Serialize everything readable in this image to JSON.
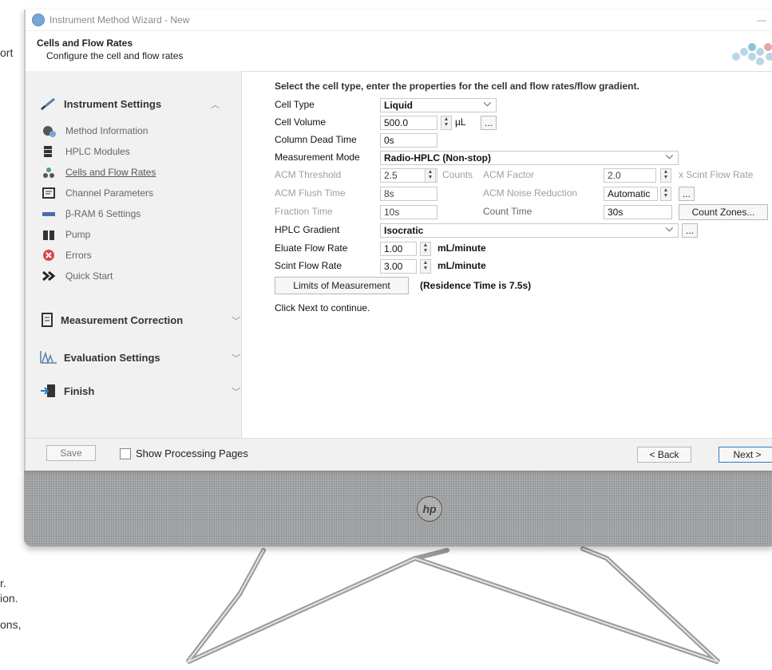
{
  "background": {
    "fragments": [
      "ort",
      "r.",
      "ion.",
      "ons,"
    ]
  },
  "window": {
    "title": "Instrument Method Wizard - New",
    "minimize_glyph": "—"
  },
  "header": {
    "title": "Cells and Flow Rates",
    "subtitle": "Configure the cell and flow rates"
  },
  "sidebar": {
    "instrument_settings": "Instrument Settings",
    "items": [
      {
        "label": "Method Information",
        "icon": "gear-icon"
      },
      {
        "label": "HPLC Modules",
        "icon": "modules-icon"
      },
      {
        "label": "Cells and Flow Rates",
        "icon": "cells-icon"
      },
      {
        "label": "Channel Parameters",
        "icon": "channel-icon"
      },
      {
        "label": "β-RAM 6 Settings",
        "icon": "bram-icon"
      },
      {
        "label": "Pump",
        "icon": "pump-icon"
      },
      {
        "label": "Errors",
        "icon": "error-icon"
      },
      {
        "label": "Quick Start",
        "icon": "quick-start-icon"
      }
    ],
    "measurement_correction": "Measurement Correction",
    "evaluation_settings": "Evaluation Settings",
    "finish": "Finish"
  },
  "form": {
    "instruction": "Select the cell type, enter the properties for the cell and flow rates/flow gradient.",
    "cell_type_label": "Cell Type",
    "cell_type_value": "Liquid",
    "cell_volume_label": "Cell Volume",
    "cell_volume_value": "500.0",
    "cell_volume_unit": "µL",
    "column_dead_time_label": "Column Dead Time",
    "column_dead_time_value": "0s",
    "measurement_mode_label": "Measurement Mode",
    "measurement_mode_value": "Radio-HPLC (Non-stop)",
    "acm_threshold_label": "ACM Threshold",
    "acm_threshold_value": "2.5",
    "acm_threshold_unit": "Counts",
    "acm_factor_label": "ACM Factor",
    "acm_factor_value": "2.0",
    "acm_factor_unit": "x Scint Flow Rate",
    "acm_flush_time_label": "ACM Flush Time",
    "acm_flush_time_value": "8s",
    "acm_noise_reduction_label": "ACM Noise Reduction",
    "acm_noise_reduction_value": "Automatic",
    "fraction_time_label": "Fraction Time",
    "fraction_time_value": "10s",
    "count_time_label": "Count Time",
    "count_time_value": "30s",
    "count_zones_button": "Count Zones...",
    "hplc_gradient_label": "HPLC Gradient",
    "hplc_gradient_value": "Isocratic",
    "eluate_flow_rate_label": "Eluate Flow Rate",
    "eluate_flow_rate_value": "1.00",
    "eluate_flow_rate_unit": "mL/minute",
    "scint_flow_rate_label": "Scint Flow Rate",
    "scint_flow_rate_value": "3.00",
    "scint_flow_rate_unit": "mL/minute",
    "limits_button": "Limits of Measurement",
    "residence_time": "(Residence Time is 7.5s)",
    "next_hint": "Click Next to continue.",
    "ellipsis": "..."
  },
  "footer": {
    "save": "Save",
    "show_processing": "Show Processing Pages",
    "back": "< Back",
    "next": "Next >"
  },
  "colors": {
    "accent": "#7aa6d6",
    "sidebar_bg": "#f1f1f1",
    "bezel": "#a9abad",
    "error": "#e0453f"
  }
}
